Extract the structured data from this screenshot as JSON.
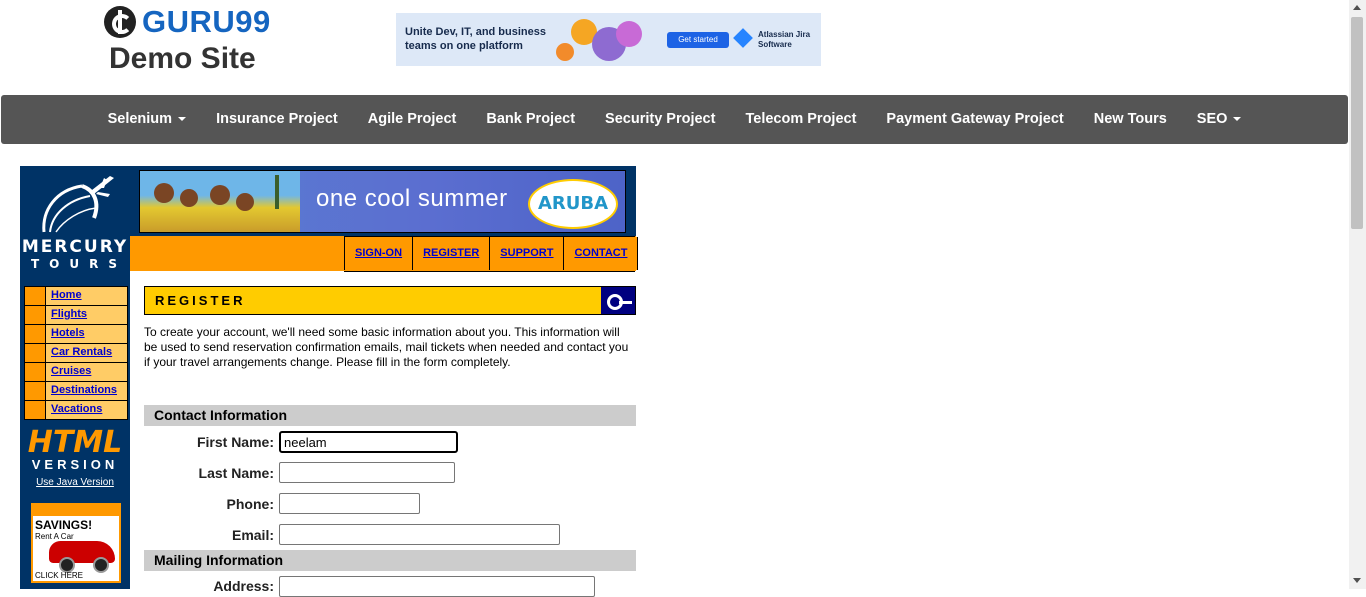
{
  "site": {
    "logo_name": "GURU99",
    "logo_sub": "Demo Site"
  },
  "ad": {
    "text": "Unite Dev, IT, and business teams on one platform",
    "button": "Get started",
    "brand": "Atlassian Jira Software"
  },
  "nav": {
    "items": [
      {
        "label": "Selenium",
        "dropdown": true
      },
      {
        "label": "Insurance Project",
        "dropdown": false
      },
      {
        "label": "Agile Project",
        "dropdown": false
      },
      {
        "label": "Bank Project",
        "dropdown": false
      },
      {
        "label": "Security Project",
        "dropdown": false
      },
      {
        "label": "Telecom Project",
        "dropdown": false
      },
      {
        "label": "Payment Gateway Project",
        "dropdown": false
      },
      {
        "label": "New Tours",
        "dropdown": false
      },
      {
        "label": "SEO",
        "dropdown": true
      }
    ]
  },
  "mercury": {
    "logo_line1": "MERCURY",
    "logo_line2": "TOURS",
    "side_menu": [
      "Home",
      "Flights",
      "Hotels",
      "Car Rentals",
      "Cruises",
      "Destinations",
      "Vacations"
    ],
    "html_word": "HTML",
    "version_word": "VERSION",
    "java_link": "Use Java Version",
    "savings_title": "SAVINGS!",
    "savings_sub": "Rent A Car",
    "savings_click": "CLICK HERE"
  },
  "banner": {
    "text": "one cool summer",
    "brand": "ARUBA"
  },
  "top_links": [
    "SIGN-ON",
    "REGISTER",
    "SUPPORT",
    "CONTACT"
  ],
  "register": {
    "title": "REGISTER",
    "intro": "To create your account, we'll need some basic information about you. This information will be used to send reservation confirmation emails, mail tickets when needed and contact you if your travel arrangements change. Please fill in the form completely."
  },
  "form": {
    "contact_header": "Contact Information",
    "mailing_header": "Mailing Information",
    "first_name_label": "First Name:",
    "first_name_value": "neelam",
    "last_name_label": "Last Name:",
    "last_name_value": "",
    "phone_label": "Phone:",
    "phone_value": "",
    "email_label": "Email:",
    "email_value": "",
    "address_label": "Address:",
    "address_value": ""
  },
  "colors": {
    "nav_bg": "#555555",
    "mercury_blue": "#003366",
    "orange": "#ff9900",
    "register_yellow": "#ffcc00",
    "section_gray": "#cccccc",
    "link_blue": "#0000cc",
    "guru_blue": "#1565c0"
  }
}
